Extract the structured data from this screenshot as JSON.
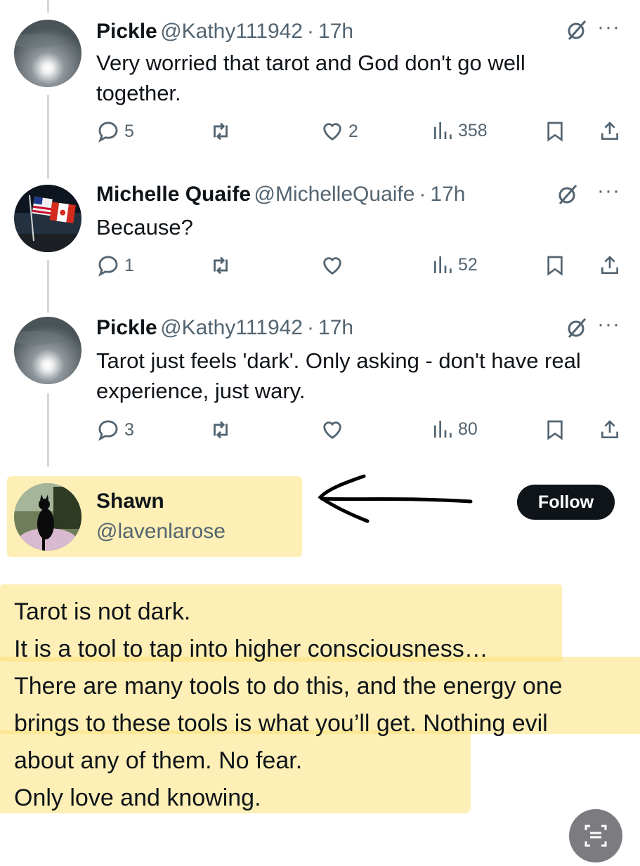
{
  "posts": [
    {
      "name": "Pickle",
      "handle": "@Kathy111942",
      "time": "17h",
      "text": "Very worried that tarot and God don't go well together.",
      "replies": "5",
      "reposts": "",
      "likes": "2",
      "views": "358"
    },
    {
      "name": "Michelle Quaife",
      "handle": "@MichelleQuaife",
      "time": "17h",
      "text": "Because?",
      "replies": "1",
      "reposts": "",
      "likes": "",
      "views": "52"
    },
    {
      "name": "Pickle",
      "handle": "@Kathy111942",
      "time": "17h",
      "text": "Tarot just feels 'dark'. Only asking - don't have real experience, just wary.",
      "replies": "3",
      "reposts": "",
      "likes": "",
      "views": "80"
    }
  ],
  "main_post": {
    "name": "Shawn",
    "handle": "@lavenlarose",
    "follow_label": "Follow",
    "lines": [
      "Tarot is not dark.",
      "It is a tool to tap into higher consciousness…",
      "There are many tools to do this, and the energy one",
      "brings to these tools is what you’ll get.  Nothing evil",
      "about any of them.  No fear.",
      "Only love and knowing."
    ]
  },
  "separator": "·",
  "colors": {
    "highlight": "#fce178",
    "secondary_text": "#536471",
    "follow_button": "#0f1419",
    "thread_line": "#cfd9de"
  },
  "icons": [
    "reply-icon",
    "repost-icon",
    "like-icon",
    "views-icon",
    "bookmark-icon",
    "share-icon",
    "grok-icon",
    "more-icon",
    "annotation-arrow",
    "scan-text-icon"
  ]
}
